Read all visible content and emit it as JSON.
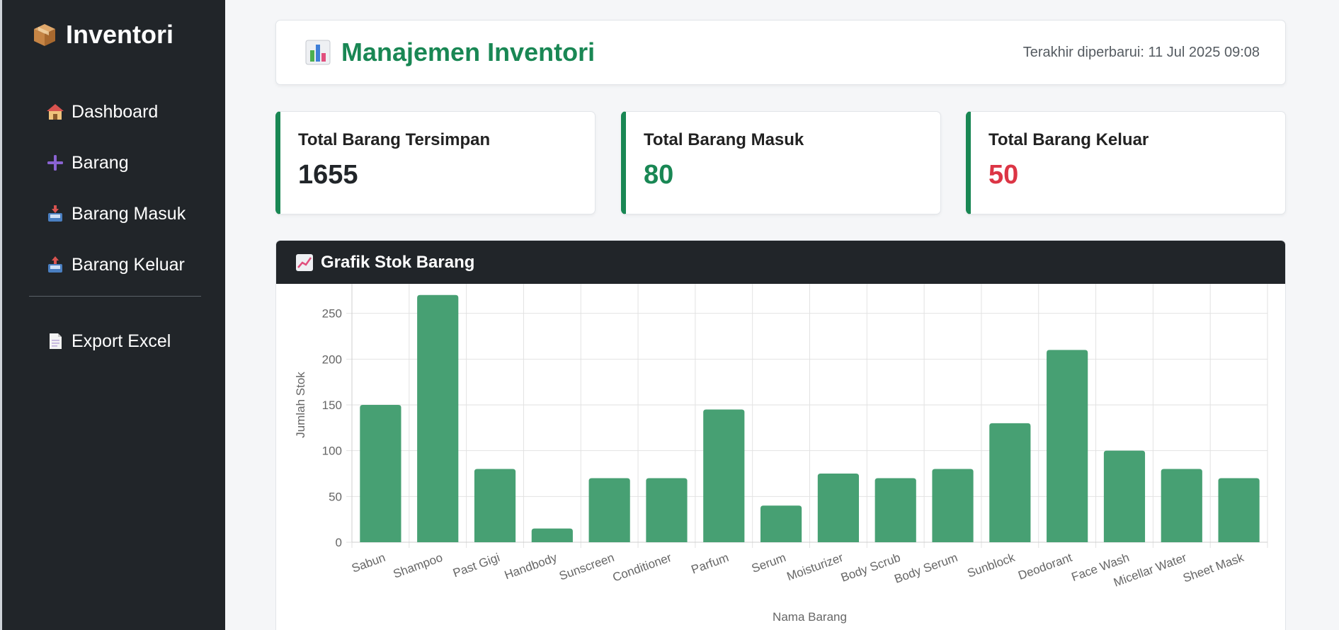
{
  "sidebar": {
    "brand": "Inventori",
    "items": [
      {
        "label": "Dashboard",
        "icon": "house-icon"
      },
      {
        "label": "Barang",
        "icon": "plus-icon"
      },
      {
        "label": "Barang Masuk",
        "icon": "inbox-tray-icon"
      },
      {
        "label": "Barang Keluar",
        "icon": "outbox-tray-icon"
      }
    ],
    "export": {
      "label": "Export Excel",
      "icon": "document-icon"
    }
  },
  "header": {
    "title": "Manajemen Inventori",
    "updated": "Terakhir diperbarui: 11 Jul 2025 09:08"
  },
  "stats": [
    {
      "label": "Total Barang Tersimpan",
      "value": "1655",
      "color": "#212529"
    },
    {
      "label": "Total Barang Masuk",
      "value": "80",
      "color": "#198754"
    },
    {
      "label": "Total Barang Keluar",
      "value": "50",
      "color": "#dc3545"
    }
  ],
  "chart_section": {
    "title": "Grafik Stok Barang"
  },
  "colors": {
    "accent": "#198754",
    "bar": "#47a073",
    "sidebar_bg": "#212529"
  },
  "chart_data": {
    "type": "bar",
    "categories": [
      "Sabun",
      "Shampoo",
      "Past Gigi",
      "Handbody",
      "Sunscreen",
      "Conditioner",
      "Parfum",
      "Serum",
      "Moisturizer",
      "Body Scrub",
      "Body Serum",
      "Sunblock",
      "Deodorant",
      "Face Wash",
      "Micellar Water",
      "Sheet Mask"
    ],
    "values": [
      150,
      270,
      80,
      15,
      70,
      70,
      145,
      40,
      75,
      70,
      80,
      130,
      210,
      100,
      80,
      70
    ],
    "xlabel": "Nama Barang",
    "ylabel": "Jumlah Stok",
    "ylim": [
      0,
      300
    ],
    "yticks": [
      0,
      50,
      100,
      150,
      200,
      250,
      300
    ],
    "grid": true
  }
}
